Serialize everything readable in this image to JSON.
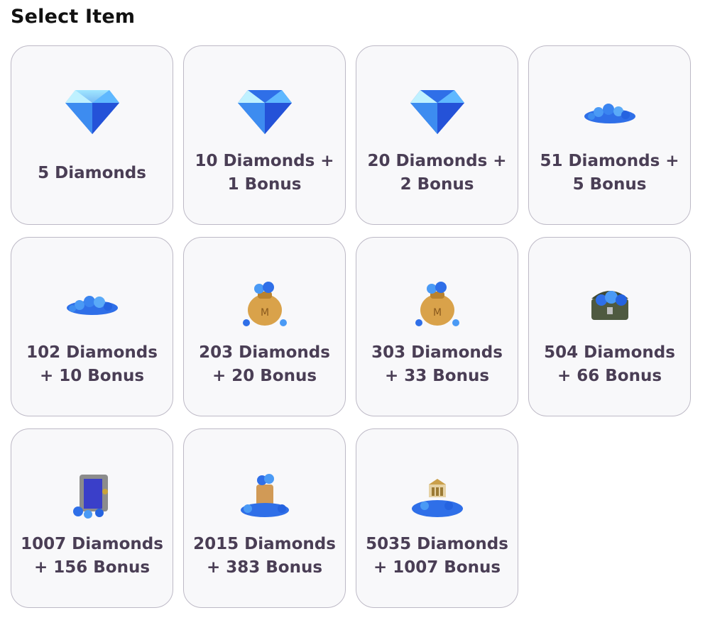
{
  "page": {
    "title": "Select Item"
  },
  "items": [
    {
      "label": "5 Diamonds",
      "icon": "diamond-icon"
    },
    {
      "label": "10 Diamonds + 1 Bonus",
      "icon": "diamond-icon"
    },
    {
      "label": "20 Diamonds + 2 Bonus",
      "icon": "diamond-icon"
    },
    {
      "label": "51 Diamonds + 5 Bonus",
      "icon": "diamond-pile-icon"
    },
    {
      "label": "102 Diamonds + 10 Bonus",
      "icon": "diamond-pile-icon"
    },
    {
      "label": "203 Diamonds + 20 Bonus",
      "icon": "diamond-bag-icon"
    },
    {
      "label": "303 Diamonds + 33 Bonus",
      "icon": "diamond-bag-icon"
    },
    {
      "label": "504 Diamonds + 66 Bonus",
      "icon": "diamond-chest-icon"
    },
    {
      "label": "1007 Diamonds + 156 Bonus",
      "icon": "diamond-safe-icon"
    },
    {
      "label": "2015 Diamonds + 383 Bonus",
      "icon": "diamond-barrel-icon"
    },
    {
      "label": "5035 Diamonds + 1007 Bonus",
      "icon": "diamond-bank-icon"
    }
  ],
  "colors": {
    "card_bg": "#f8f8fa",
    "card_border": "#bdb9c6",
    "label": "#4a3e55",
    "diamond": "#2f6fe8"
  }
}
